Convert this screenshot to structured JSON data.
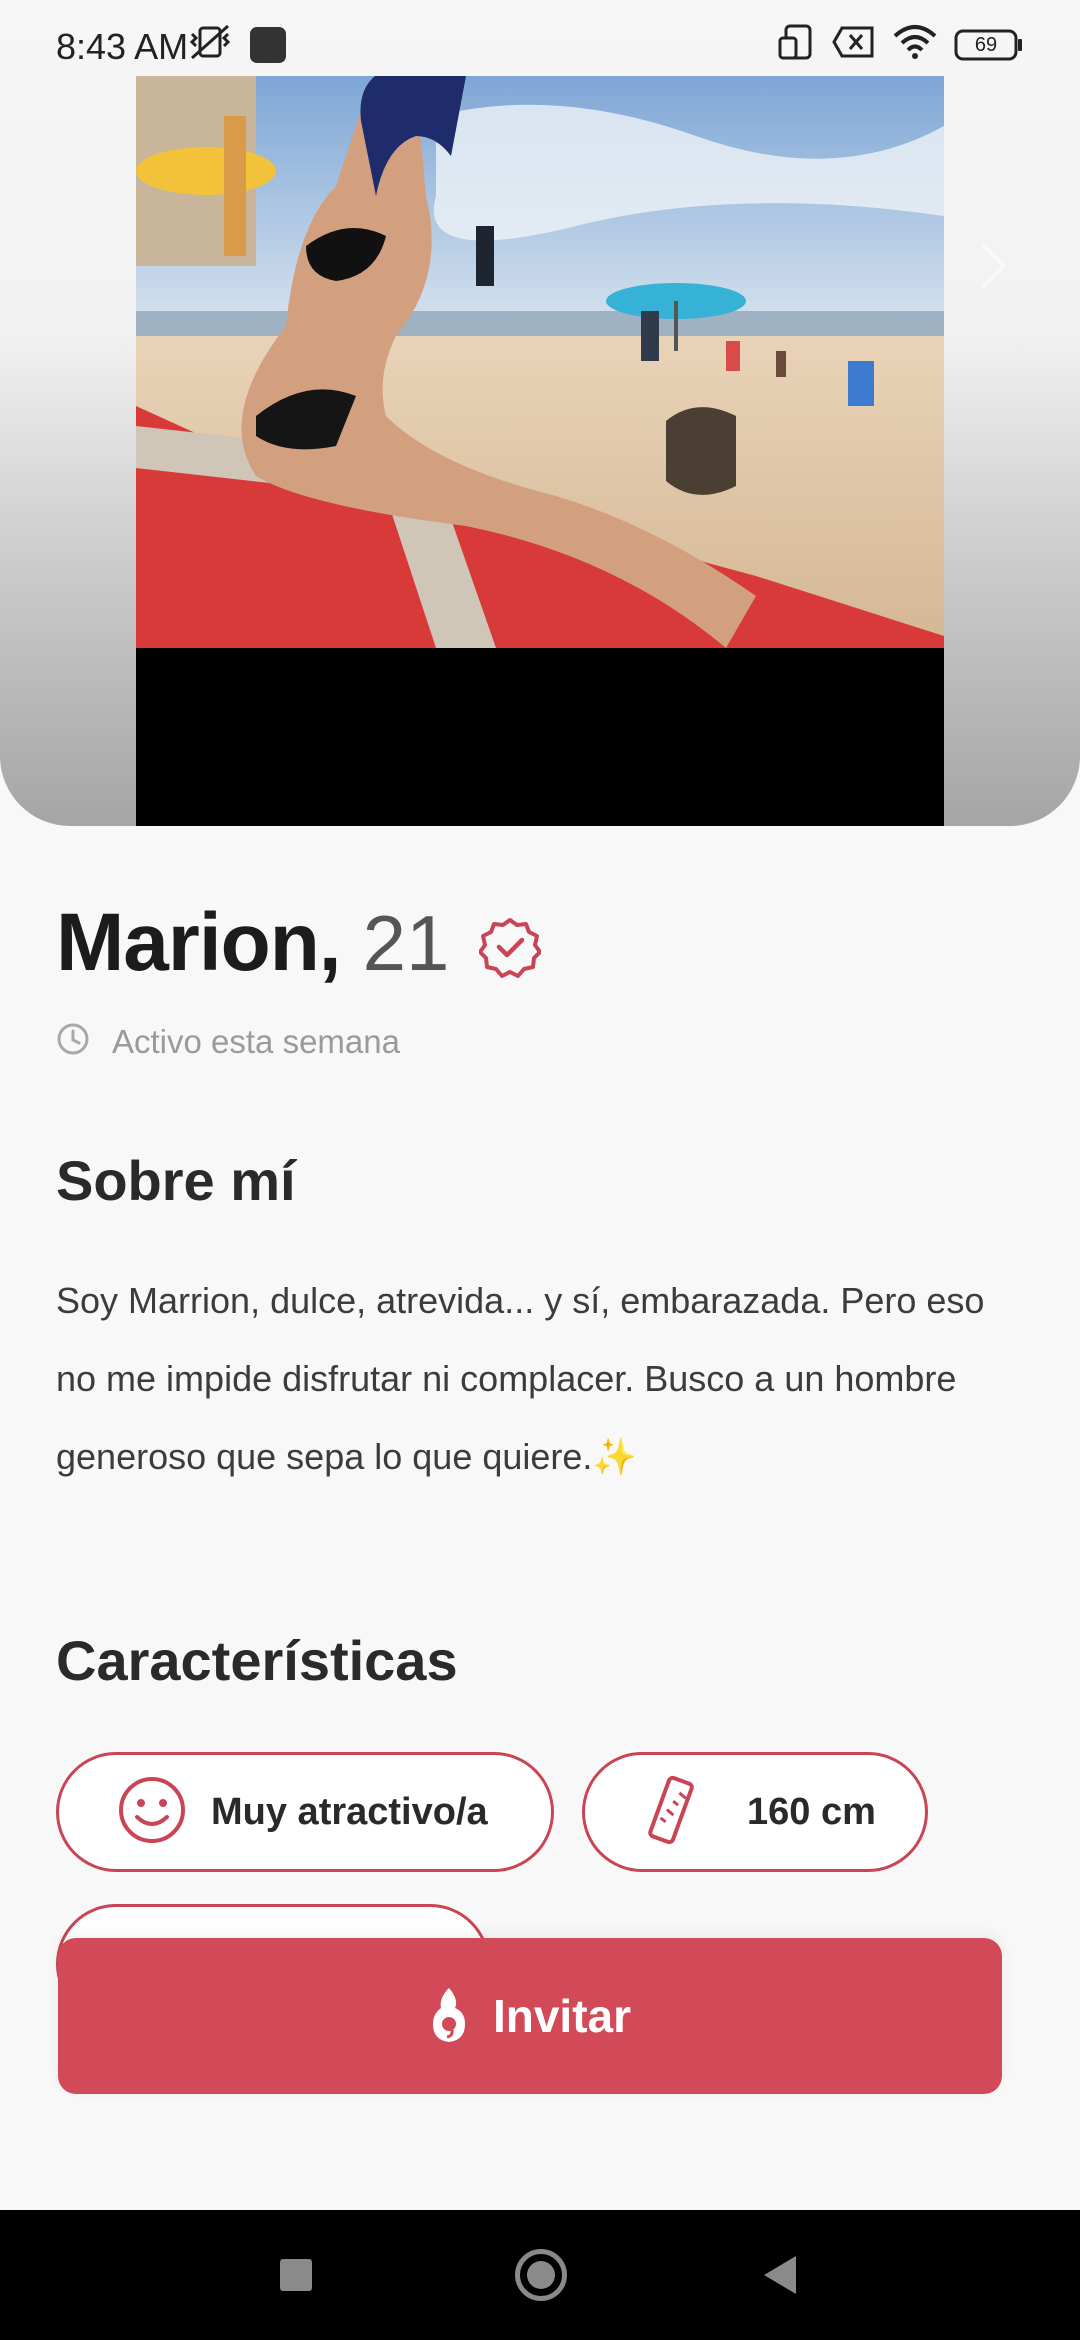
{
  "status_bar": {
    "time": "8:43 AM",
    "battery": "69"
  },
  "profile": {
    "name": "Marion,",
    "age": "21",
    "activity": "Activo esta semana"
  },
  "about": {
    "title": "Sobre mí",
    "text": "Soy Marrion, dulce, atrevida... y sí, embarazada. Pero eso no me impide disfrutar ni complacer. Busco a un hombre generoso que sepa lo que quiere.✨"
  },
  "traits": {
    "title": "Características",
    "chips": [
      {
        "label": "Muy atractivo/a",
        "icon": "smiley-icon"
      },
      {
        "label": "160 cm",
        "icon": "ruler-icon"
      }
    ]
  },
  "cta": {
    "label": "Invitar",
    "icon": "flame-icon"
  },
  "colors": {
    "accent": "#d24a58",
    "chip_border": "#c94454",
    "verified": "#c94454"
  }
}
